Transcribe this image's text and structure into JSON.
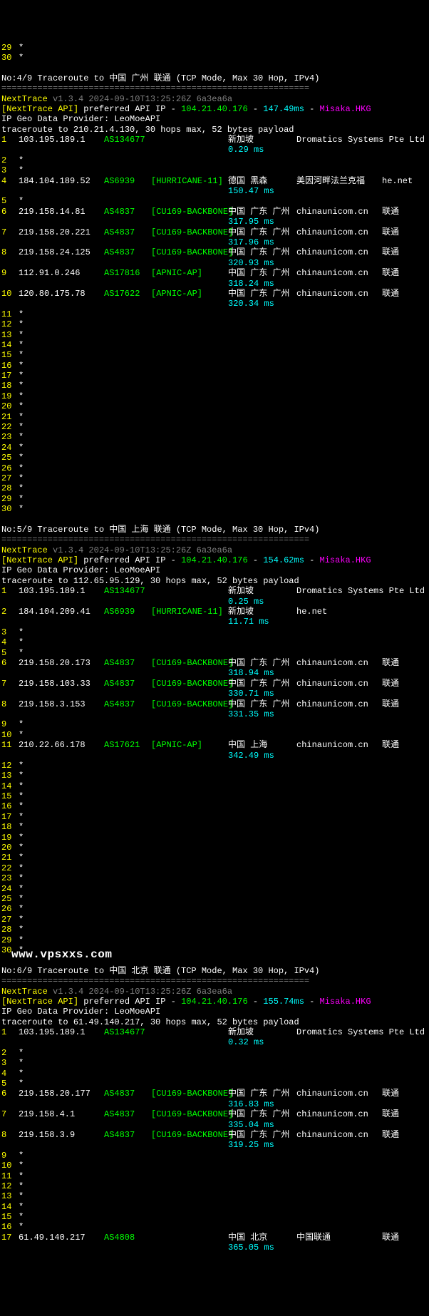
{
  "pre_hops": [
    {
      "n": "29",
      "star": true
    },
    {
      "n": "30",
      "star": true
    }
  ],
  "traces": [
    {
      "title": "No:4/9 Traceroute to 中国 广州 联通 (TCP Mode, Max 30 Hop, IPv4)",
      "sep": "============================================================",
      "nt": "NextTrace",
      "ver": "v1.3.4 2024-09-10T13:25:26Z 6a3ea6a",
      "api_label": "[NextTrace API]",
      "api_text": " preferred API IP - ",
      "api_ip": "104.21.40.176",
      "api_dash": " - ",
      "api_ms": "147.49ms",
      "api_dash2": " - ",
      "api_srv": "Misaka.HKG",
      "provider": "IP Geo Data Provider: LeoMoeAPI",
      "target": "traceroute to 210.21.4.130, 30 hops max, 52 bytes payload",
      "hops": [
        {
          "n": "1",
          "ip": "103.195.189.1",
          "as": "AS134677",
          "net": "",
          "loc": "新加坡",
          "ms": "0.29 ms",
          "org": "Dromatics Systems Pte Ltd",
          "isp": ""
        },
        {
          "n": "2",
          "star": true
        },
        {
          "n": "3",
          "star": true
        },
        {
          "n": "4",
          "ip": "184.104.189.52",
          "as": "AS6939",
          "net": "[HURRICANE-11]",
          "loc": "德国 黑森",
          "ms": "150.47 ms",
          "org": "美因河畔法兰克福",
          "isp": "he.net"
        },
        {
          "n": "5",
          "star": true
        },
        {
          "n": "6",
          "ip": "219.158.14.81",
          "as": "AS4837",
          "net": "[CU169-BACKBONE]",
          "loc": "中国 广东 广州",
          "ms": "317.95 ms",
          "org": "chinaunicom.cn",
          "isp": "联通"
        },
        {
          "n": "7",
          "ip": "219.158.20.221",
          "as": "AS4837",
          "net": "[CU169-BACKBONE]",
          "loc": "中国 广东 广州",
          "ms": "317.96 ms",
          "org": "chinaunicom.cn",
          "isp": "联通"
        },
        {
          "n": "8",
          "ip": "219.158.24.125",
          "as": "AS4837",
          "net": "[CU169-BACKBONE]",
          "loc": "中国 广东 广州",
          "ms": "320.93 ms",
          "org": "chinaunicom.cn",
          "isp": "联通"
        },
        {
          "n": "9",
          "ip": "112.91.0.246",
          "as": "AS17816",
          "net": "[APNIC-AP]",
          "loc": "中国 广东 广州",
          "ms": "318.24 ms",
          "org": "chinaunicom.cn",
          "isp": "联通"
        },
        {
          "n": "10",
          "ip": "120.80.175.78",
          "as": "AS17622",
          "net": "[APNIC-AP]",
          "loc": "中国 广东 广州",
          "ms": "320.34 ms",
          "org": "chinaunicom.cn",
          "isp": "联通"
        },
        {
          "n": "11",
          "star": true
        },
        {
          "n": "12",
          "star": true
        },
        {
          "n": "13",
          "star": true
        },
        {
          "n": "14",
          "star": true
        },
        {
          "n": "15",
          "star": true
        },
        {
          "n": "16",
          "star": true
        },
        {
          "n": "17",
          "star": true
        },
        {
          "n": "18",
          "star": true
        },
        {
          "n": "19",
          "star": true
        },
        {
          "n": "20",
          "star": true
        },
        {
          "n": "21",
          "star": true
        },
        {
          "n": "22",
          "star": true
        },
        {
          "n": "23",
          "star": true
        },
        {
          "n": "24",
          "star": true
        },
        {
          "n": "25",
          "star": true
        },
        {
          "n": "26",
          "star": true
        },
        {
          "n": "27",
          "star": true
        },
        {
          "n": "28",
          "star": true
        },
        {
          "n": "29",
          "star": true
        },
        {
          "n": "30",
          "star": true
        }
      ]
    },
    {
      "title": "No:5/9 Traceroute to 中国 上海 联通 (TCP Mode, Max 30 Hop, IPv4)",
      "sep": "============================================================",
      "nt": "NextTrace",
      "ver": "v1.3.4 2024-09-10T13:25:26Z 6a3ea6a",
      "api_label": "[NextTrace API]",
      "api_text": " preferred API IP - ",
      "api_ip": "104.21.40.176",
      "api_dash": " - ",
      "api_ms": "154.62ms",
      "api_dash2": " - ",
      "api_srv": "Misaka.HKG",
      "provider": "IP Geo Data Provider: LeoMoeAPI",
      "target": "traceroute to 112.65.95.129, 30 hops max, 52 bytes payload",
      "hops": [
        {
          "n": "1",
          "ip": "103.195.189.1",
          "as": "AS134677",
          "net": "",
          "loc": "新加坡",
          "ms": "0.25 ms",
          "org": "Dromatics Systems Pte Ltd",
          "isp": ""
        },
        {
          "n": "2",
          "ip": "184.104.209.41",
          "as": "AS6939",
          "net": "[HURRICANE-11]",
          "loc": "新加坡",
          "ms": "11.71 ms",
          "org": "he.net",
          "isp": ""
        },
        {
          "n": "3",
          "star": true
        },
        {
          "n": "4",
          "star": true
        },
        {
          "n": "5",
          "star": true
        },
        {
          "n": "6",
          "ip": "219.158.20.173",
          "as": "AS4837",
          "net": "[CU169-BACKBONE]",
          "loc": "中国 广东 广州",
          "ms": "318.94 ms",
          "org": "chinaunicom.cn",
          "isp": "联通"
        },
        {
          "n": "7",
          "ip": "219.158.103.33",
          "as": "AS4837",
          "net": "[CU169-BACKBONE]",
          "loc": "中国 广东 广州",
          "ms": "330.71 ms",
          "org": "chinaunicom.cn",
          "isp": "联通"
        },
        {
          "n": "8",
          "ip": "219.158.3.153",
          "as": "AS4837",
          "net": "[CU169-BACKBONE]",
          "loc": "中国 广东 广州",
          "ms": "331.35 ms",
          "org": "chinaunicom.cn",
          "isp": "联通"
        },
        {
          "n": "9",
          "star": true
        },
        {
          "n": "10",
          "star": true
        },
        {
          "n": "11",
          "ip": "210.22.66.178",
          "as": "AS17621",
          "net": "[APNIC-AP]",
          "loc": "中国 上海",
          "ms": "342.49 ms",
          "org": "chinaunicom.cn",
          "isp": "联通"
        },
        {
          "n": "12",
          "star": true
        },
        {
          "n": "13",
          "star": true
        },
        {
          "n": "14",
          "star": true
        },
        {
          "n": "15",
          "star": true
        },
        {
          "n": "16",
          "star": true
        },
        {
          "n": "17",
          "star": true
        },
        {
          "n": "18",
          "star": true
        },
        {
          "n": "19",
          "star": true
        },
        {
          "n": "20",
          "star": true
        },
        {
          "n": "21",
          "star": true
        },
        {
          "n": "22",
          "star": true
        },
        {
          "n": "23",
          "star": true
        },
        {
          "n": "24",
          "star": true
        },
        {
          "n": "25",
          "star": true
        },
        {
          "n": "26",
          "star": true
        },
        {
          "n": "27",
          "star": true
        },
        {
          "n": "28",
          "star": true
        },
        {
          "n": "29",
          "star": true
        },
        {
          "n": "30",
          "star": true
        }
      ],
      "watermark": "www.vpsxxs.com"
    },
    {
      "title": "No:6/9 Traceroute to 中国 北京 联通 (TCP Mode, Max 30 Hop, IPv4)",
      "sep": "============================================================",
      "nt": "NextTrace",
      "ver": "v1.3.4 2024-09-10T13:25:26Z 6a3ea6a",
      "api_label": "[NextTrace API]",
      "api_text": " preferred API IP - ",
      "api_ip": "104.21.40.176",
      "api_dash": " - ",
      "api_ms": "155.74ms",
      "api_dash2": " - ",
      "api_srv": "Misaka.HKG",
      "provider": "IP Geo Data Provider: LeoMoeAPI",
      "target": "traceroute to 61.49.140.217, 30 hops max, 52 bytes payload",
      "hops": [
        {
          "n": "1",
          "ip": "103.195.189.1",
          "as": "AS134677",
          "net": "",
          "loc": "新加坡",
          "ms": "0.32 ms",
          "org": "Dromatics Systems Pte Ltd",
          "isp": ""
        },
        {
          "n": "2",
          "star": true
        },
        {
          "n": "3",
          "star": true
        },
        {
          "n": "4",
          "star": true
        },
        {
          "n": "5",
          "star": true
        },
        {
          "n": "6",
          "ip": "219.158.20.177",
          "as": "AS4837",
          "net": "[CU169-BACKBONE]",
          "loc": "中国 广东 广州",
          "ms": "316.83 ms",
          "org": "chinaunicom.cn",
          "isp": "联通"
        },
        {
          "n": "7",
          "ip": "219.158.4.1",
          "as": "AS4837",
          "net": "[CU169-BACKBONE]",
          "loc": "中国 广东 广州",
          "ms": "335.04 ms",
          "org": "chinaunicom.cn",
          "isp": "联通"
        },
        {
          "n": "8",
          "ip": "219.158.3.9",
          "as": "AS4837",
          "net": "[CU169-BACKBONE]",
          "loc": "中国 广东 广州",
          "ms": "319.25 ms",
          "org": "chinaunicom.cn",
          "isp": "联通"
        },
        {
          "n": "9",
          "star": true
        },
        {
          "n": "10",
          "star": true
        },
        {
          "n": "11",
          "star": true
        },
        {
          "n": "12",
          "star": true
        },
        {
          "n": "13",
          "star": true
        },
        {
          "n": "14",
          "star": true
        },
        {
          "n": "15",
          "star": true
        },
        {
          "n": "16",
          "star": true
        },
        {
          "n": "17",
          "ip": "61.49.140.217",
          "as": "AS4808",
          "net": "",
          "loc": "中国 北京",
          "ms": "365.05 ms",
          "org": "中国联通",
          "isp": "联通"
        }
      ]
    }
  ]
}
